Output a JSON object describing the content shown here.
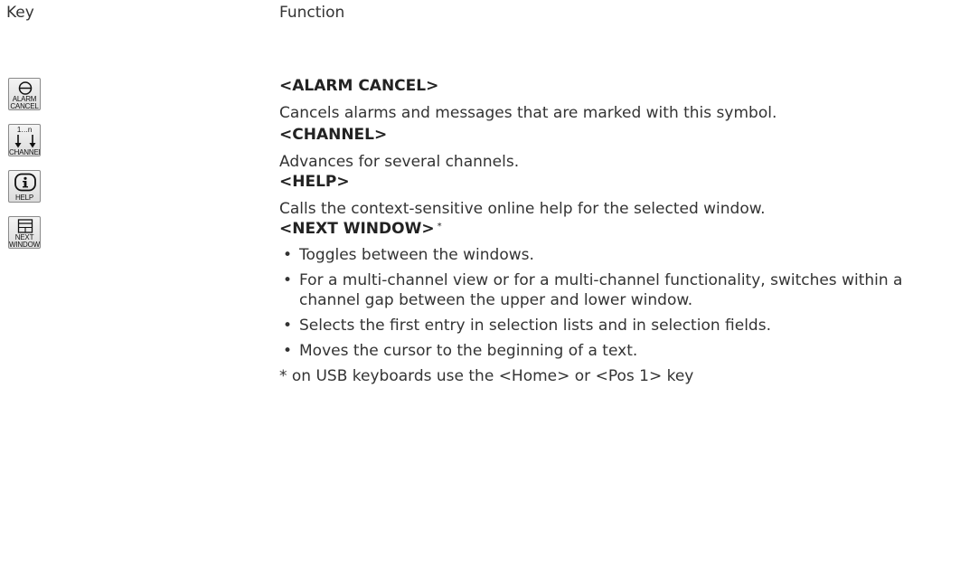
{
  "header": {
    "key_label": "Key",
    "function_label": "Function"
  },
  "entries": [
    {
      "icon": "alarm-cancel-icon",
      "key_text": [
        "ALARM",
        "CANCEL"
      ],
      "title": "<ALARM CANCEL>",
      "description": "Cancels alarms and messages that are marked with this symbol."
    },
    {
      "icon": "channel-icon",
      "key_text": [
        "1…n",
        "CHANNEL"
      ],
      "title": "<CHANNEL>",
      "description": "Advances for several channels."
    },
    {
      "icon": "help-icon",
      "key_text": [
        "HELP"
      ],
      "title": "<HELP>",
      "description": "Calls the context-sensitive online help for the selected window."
    },
    {
      "icon": "next-window-icon",
      "key_text": [
        "NEXT",
        "WINDOW"
      ],
      "title": "<NEXT WINDOW>",
      "title_marker": "*",
      "bullets": [
        "Toggles between the windows.",
        "For a multi-channel view or for a multi-channel functionality, switches within a channel gap between the upper and lower window.",
        "Selects the first entry in selection lists and in selection fields.",
        "Moves the cursor to the beginning of a text."
      ],
      "footnote": "* on USB keyboards use the <Home> or <Pos 1> key"
    }
  ]
}
